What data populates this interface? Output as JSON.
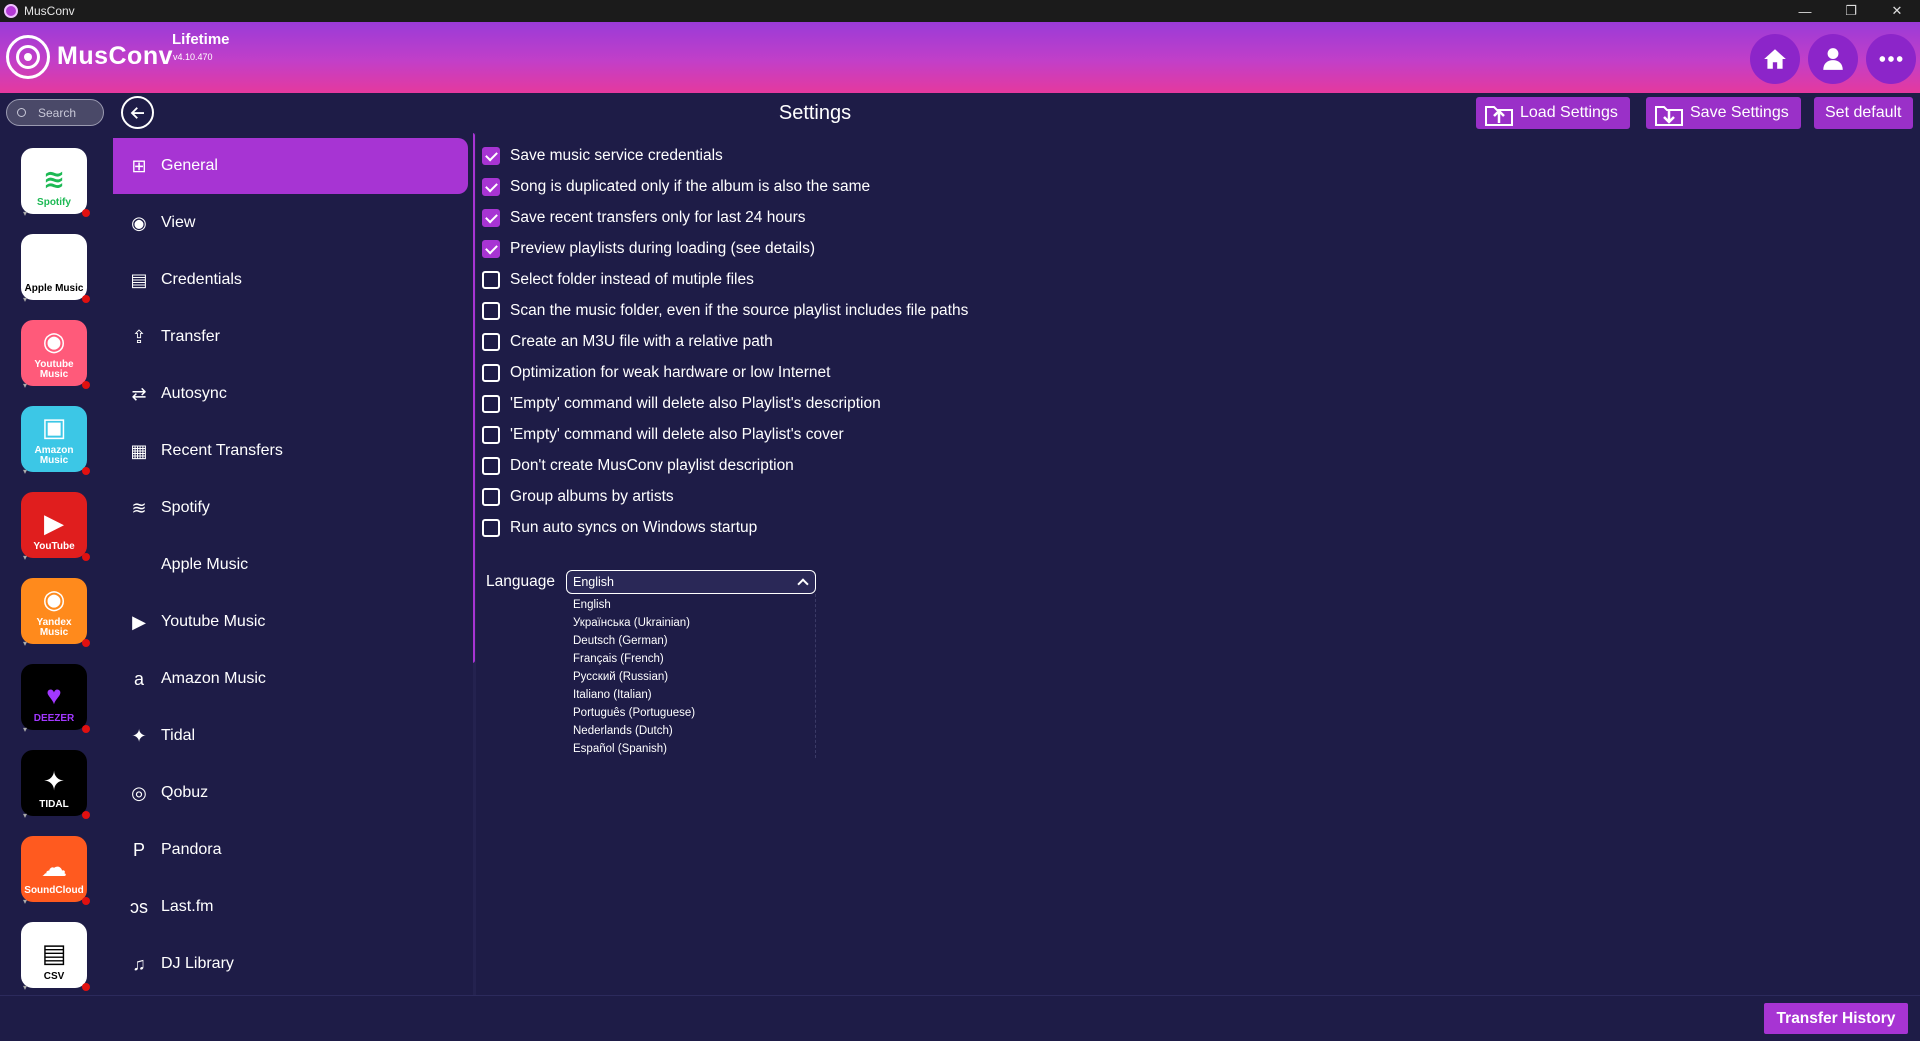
{
  "window": {
    "title": "MusConv",
    "controls": [
      "—",
      "❐",
      "✕"
    ]
  },
  "header": {
    "brand": "MusConv",
    "plan": "Lifetime",
    "version": "v4.10.470"
  },
  "toolbar": {
    "search_placeholder": "Search",
    "page_title": "Settings",
    "load_label": "Load Settings",
    "save_label": "Save Settings",
    "default_label": "Set default"
  },
  "services": [
    {
      "label": "Spotify",
      "bg": "#ffffff",
      "fg": "#1db954",
      "glyph": "≋"
    },
    {
      "label": "Apple Music",
      "bg": "#ffffff",
      "fg": "#000000",
      "glyph": ""
    },
    {
      "label": "Youtube Music",
      "bg": "#ff5a7a",
      "fg": "#ffffff",
      "glyph": "◉"
    },
    {
      "label": "Amazon Music",
      "bg": "#3cc7e6",
      "fg": "#ffffff",
      "glyph": "▣"
    },
    {
      "label": "YouTube",
      "bg": "#e01e1e",
      "fg": "#ffffff",
      "glyph": "▶"
    },
    {
      "label": "Yandex Music",
      "bg": "#ff8a1c",
      "fg": "#ffffff",
      "glyph": "◉"
    },
    {
      "label": "DEEZER",
      "bg": "#000000",
      "fg": "#a238ff",
      "glyph": "♥"
    },
    {
      "label": "TIDAL",
      "bg": "#000000",
      "fg": "#ffffff",
      "glyph": "✦"
    },
    {
      "label": "SoundCloud",
      "bg": "#ff5a1f",
      "fg": "#ffffff",
      "glyph": "☁"
    },
    {
      "label": "CSV",
      "bg": "#ffffff",
      "fg": "#000000",
      "glyph": "▤"
    }
  ],
  "nav": [
    {
      "label": "General",
      "icon": "grid-icon",
      "glyph": "⊞"
    },
    {
      "label": "View",
      "icon": "eye-icon",
      "glyph": "◉"
    },
    {
      "label": "Credentials",
      "icon": "id-card-icon",
      "glyph": "▤"
    },
    {
      "label": "Transfer",
      "icon": "share-icon",
      "glyph": "⇪"
    },
    {
      "label": "Autosync",
      "icon": "sync-icon",
      "glyph": "⇄"
    },
    {
      "label": "Recent Transfers",
      "icon": "calendar-icon",
      "glyph": "▦"
    },
    {
      "label": "Spotify",
      "icon": "spotify-icon",
      "glyph": "≋"
    },
    {
      "label": "Apple Music",
      "icon": "apple-icon",
      "glyph": ""
    },
    {
      "label": "Youtube Music",
      "icon": "youtube-icon",
      "glyph": "▶"
    },
    {
      "label": "Amazon Music",
      "icon": "amazon-icon",
      "glyph": "a"
    },
    {
      "label": "Tidal",
      "icon": "tidal-icon",
      "glyph": "✦"
    },
    {
      "label": "Qobuz",
      "icon": "qobuz-icon",
      "glyph": "◎"
    },
    {
      "label": "Pandora",
      "icon": "pandora-icon",
      "glyph": "P"
    },
    {
      "label": "Last.fm",
      "icon": "lastfm-icon",
      "glyph": "ↄs"
    },
    {
      "label": "DJ Library",
      "icon": "dj-library-icon",
      "glyph": "♫"
    }
  ],
  "options": [
    {
      "label": "Save music service credentials",
      "checked": true
    },
    {
      "label": "Song is duplicated only if the album is also the same",
      "checked": true
    },
    {
      "label": "Save recent transfers only for last 24 hours",
      "checked": true
    },
    {
      "label": "Preview playlists during loading (see details)",
      "checked": true
    },
    {
      "label": "Select folder instead of mutiple files",
      "checked": false
    },
    {
      "label": "Scan the music folder, even if the source playlist includes file paths",
      "checked": false
    },
    {
      "label": "Create an M3U file with a relative path",
      "checked": false
    },
    {
      "label": "Optimization for weak hardware or low Internet",
      "checked": false
    },
    {
      "label": "'Empty' command will delete also Playlist's description",
      "checked": false
    },
    {
      "label": "'Empty' command will delete also Playlist's cover",
      "checked": false
    },
    {
      "label": "Don't create MusConv playlist description",
      "checked": false
    },
    {
      "label": "Group albums by artists",
      "checked": false
    },
    {
      "label": "Run auto syncs on Windows startup",
      "checked": false
    }
  ],
  "language": {
    "label": "Language",
    "selected": "English",
    "options": [
      "English",
      "Українська (Ukrainian)",
      "Deutsch (German)",
      "Français (French)",
      "Русский (Russian)",
      "Italiano (Italian)",
      "Português (Portuguese)",
      "Nederlands (Dutch)",
      "Español (Spanish)"
    ]
  },
  "footer": {
    "history_label": "Transfer History"
  },
  "colors": {
    "accent": "#a734d3",
    "background": "#1e1c47",
    "header_start": "#9a3bd8",
    "header_end": "#e5399e"
  }
}
